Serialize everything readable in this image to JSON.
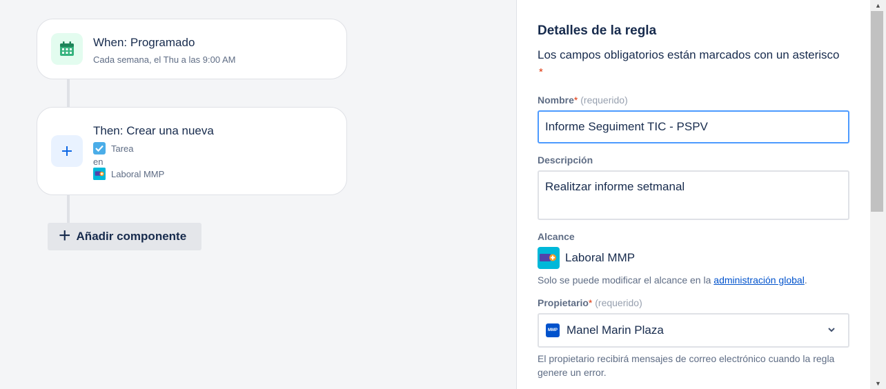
{
  "trigger": {
    "title": "When: Programado",
    "subtitle": "Cada semana, el Thu a las 9:00 AM",
    "icon": "calendar-icon",
    "icon_color": "#36b37e"
  },
  "action": {
    "title": "Then: Crear una nueva",
    "issue_type": "Tarea",
    "in_label": "en",
    "project": "Laboral MMP",
    "icon": "plus-icon",
    "icon_color": "#0c66e4"
  },
  "add_component": {
    "label": "Añadir componente",
    "icon": "plus-icon"
  },
  "panel": {
    "title": "Detalles de la regla",
    "description": "Los campos obligatorios están marcados con un asterisco",
    "required_star": "*",
    "name": {
      "label": "Nombre",
      "star": "*",
      "required": "(requerido)",
      "value": "Informe Seguiment TIC - PSPV"
    },
    "description_field": {
      "label": "Descripción",
      "value": "Realitzar informe setmanal"
    },
    "scope": {
      "label": "Alcance",
      "value": "Laboral MMP",
      "helper_prefix": "Solo se puede modificar el alcance en la ",
      "helper_link": "administración global",
      "helper_suffix": "."
    },
    "owner": {
      "label": "Propietario",
      "star": "*",
      "required": "(requerido)",
      "avatar_text": "MMP",
      "value": "Manel Marin Plaza",
      "helper": "El propietario recibirá mensajes de correo electrónico cuando la regla genere un error."
    }
  },
  "scrollbar": {
    "up": "▲",
    "down": "▼"
  }
}
